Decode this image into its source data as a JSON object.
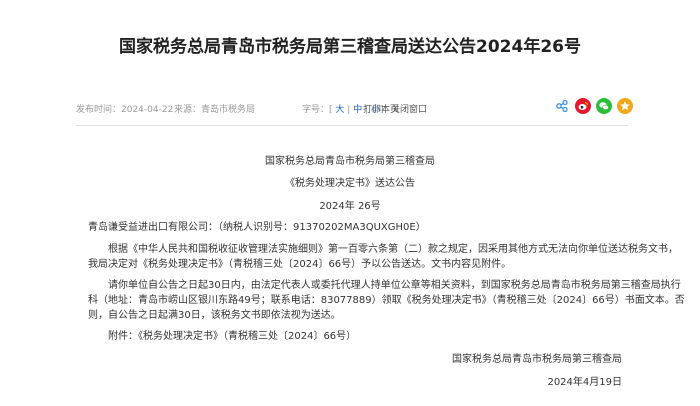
{
  "header": {
    "title": "国家税务总局青岛市税务局第三稽查局送达公告2024年26号"
  },
  "meta": {
    "publish_date": "发布时间：2024-04-22",
    "source": "来源：青岛市税务局",
    "font_size_label": "字号：",
    "font_large": "大",
    "font_medium": "中",
    "font_small": "小",
    "print_label": "打印本页",
    "close_label": "关闭窗口"
  },
  "share": {
    "icons": [
      "share-icon",
      "weibo-icon",
      "wechat-icon",
      "favorite-icon"
    ],
    "colors": {
      "share": "#3b8fd6",
      "weibo": "#e6162d",
      "wechat": "#2ebd3a",
      "favorite": "#f0a81a"
    }
  },
  "article": {
    "issuer": "国家税务总局青岛市税务局第三稽查局",
    "doc_title": "《税务处理决定书》送达公告",
    "doc_number": "2024年 26号",
    "addressee": "青岛谦受益进出口有限公司：（纳税人识别号：91370202MA3QUXGH0E）",
    "para1_line1": "根据《中华人民共和国税收征收管理法实施细则》第一百零六条第（二）款之规定，因采用其他方式无法向你单位送达税务文书，",
    "para1_line2": "我局决定对《税务处理决定书》（青税稽三处〔2024〕66号）予以公告送达。文书内容见附件。",
    "para2_line1": "请你单位自公告之日起30日内，由法定代表人或委托代理人持单位公章等相关资料，到国家税务总局青岛市税务局第三稽查局执行",
    "para2_line2": "科（地址：青岛市崂山区银川东路49号；联系电话：83077889）领取《税务处理决定书》（青税稽三处〔2024〕66号）书面文本。否",
    "para2_line3": "则，自公告之日起满30日，该税务文书即依法视为送达。",
    "attachment": "附件：《税务处理决定书》（青税稽三处〔2024〕66号）",
    "signature": "国家税务总局青岛市税务局第三稽查局",
    "sign_date": "2024年4月19日"
  }
}
